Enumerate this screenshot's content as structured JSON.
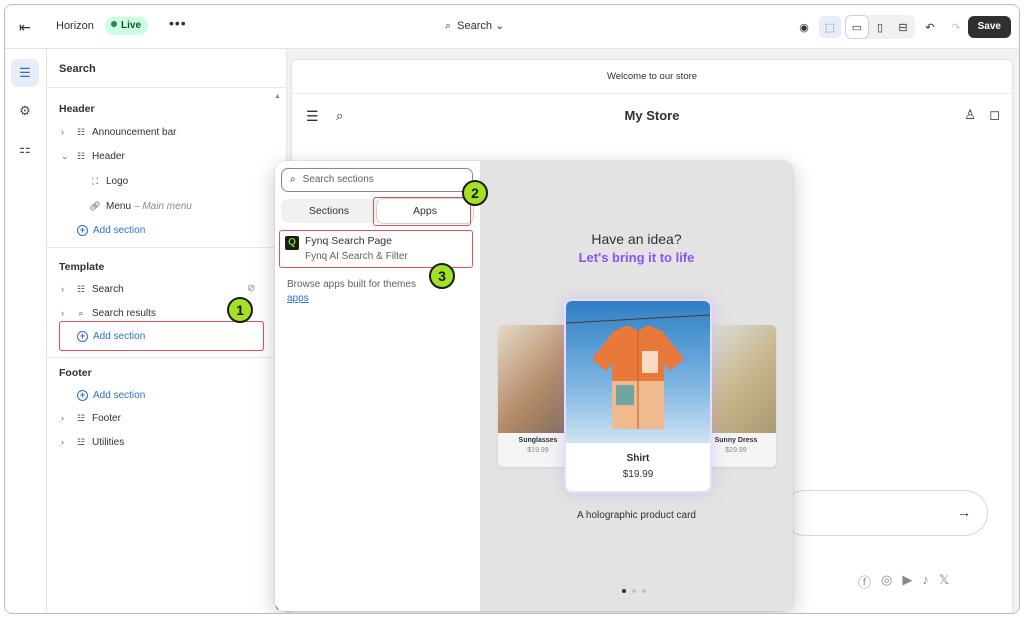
{
  "topbar": {
    "theme_name": "Horizon",
    "live_badge": "Live",
    "more": "•••",
    "page_selector": "Search",
    "save_label": "Save"
  },
  "sidebar": {
    "title": "Search",
    "header_group": "Header",
    "announcement_bar": "Announcement bar",
    "header_item": "Header",
    "logo": "Logo",
    "menu": "Menu",
    "menu_sub": "– Main menu",
    "add_section_header": "Add section",
    "template_group": "Template",
    "search_item": "Search",
    "search_results": "Search results",
    "add_section_template": "Add section",
    "footer_group": "Footer",
    "add_section_footer": "Add section",
    "footer_item": "Footer",
    "utilities": "Utilities"
  },
  "preview": {
    "announcement": "Welcome to our store",
    "store_name": "My Store"
  },
  "popover": {
    "search_placeholder": "Search sections",
    "tab_sections": "Sections",
    "tab_apps": "Apps",
    "app_name": "Fynq Search Page",
    "app_subtitle": "Fynq AI Search & Filter",
    "browse_text": "Browse apps built for themes",
    "browse_link": "apps",
    "promo_title": "Have an idea?",
    "promo_subtitle": "Let's bring it to life",
    "card_left_name": "Sunglasses",
    "card_left_price": "$19.99",
    "card_main_name": "Shirt",
    "card_main_price": "$19.99",
    "card_right_name": "Sunny Dress",
    "card_right_price": "$29.99",
    "caption": "A holographic product card"
  },
  "steps": [
    "1",
    "2",
    "3"
  ],
  "colors": {
    "accent": "#2c6ecb",
    "live_badge_bg": "#cdfee1",
    "promo_purple": "#8c52f0",
    "step_badge": "#a4e024",
    "highlight_red": "#e05252"
  }
}
